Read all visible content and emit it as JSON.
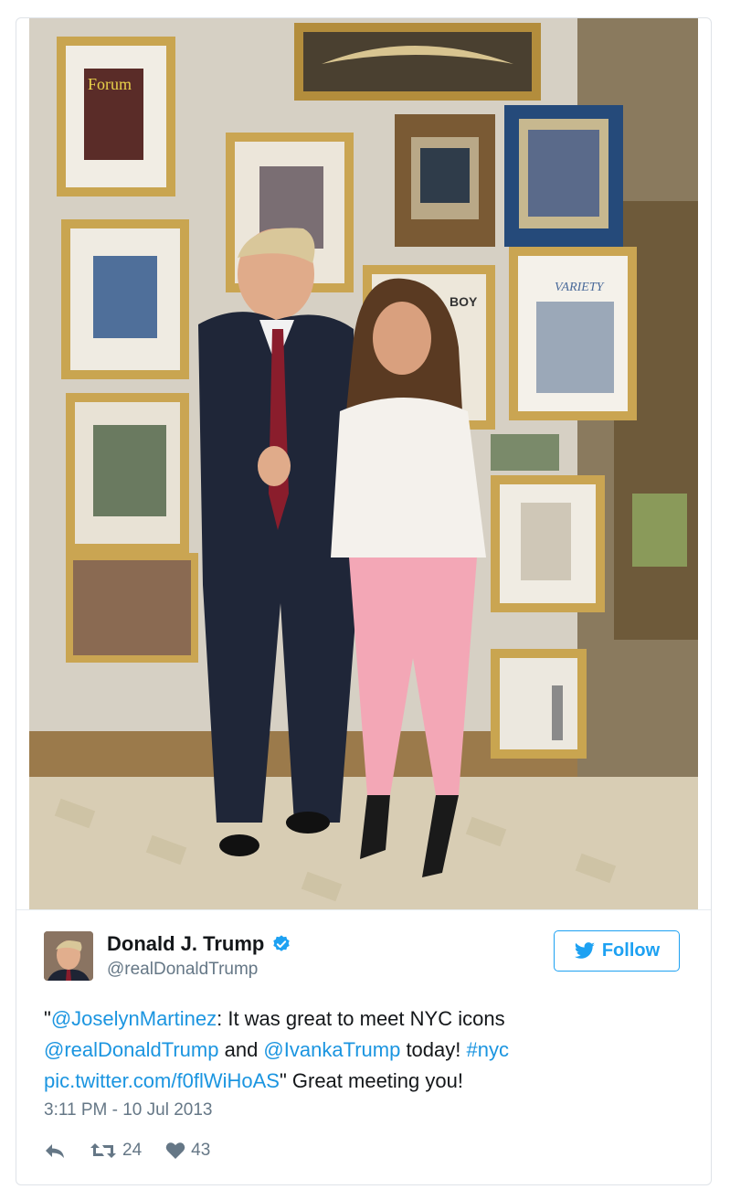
{
  "tweet": {
    "author_name": "Donald J. Trump",
    "handle": "@realDonaldTrump",
    "follow_label": "Follow",
    "text_parts": {
      "quote_open": "\"",
      "mention1": "@JoselynMartinez",
      "t1": ": It was great to meet NYC icons ",
      "mention2": "@realDonaldTrump",
      "t2": " and ",
      "mention3": "@IvankaTrump",
      "t3": " today! ",
      "hashtag": "#nyc",
      "t4": " ",
      "pic_link": "pic.twitter.com/f0flWiHoAS",
      "t5": "\" Great meeting you!"
    },
    "timestamp": "3:11 PM - 10 Jul 2013",
    "retweets": "24",
    "likes": "43"
  },
  "photo": {
    "frame_texts": {
      "forum": "Forum",
      "variety": "VARIETY",
      "boy": "BOY"
    }
  },
  "colors": {
    "link": "#1b95e0",
    "verified": "#1da1f2",
    "follow_border": "#1da1f2",
    "muted": "#657786",
    "text": "#14171a"
  },
  "icons": {
    "reply": "reply-icon",
    "retweet": "retweet-icon",
    "like": "heart-icon",
    "verified": "verified-badge-icon",
    "twitter": "twitter-bird-icon"
  }
}
